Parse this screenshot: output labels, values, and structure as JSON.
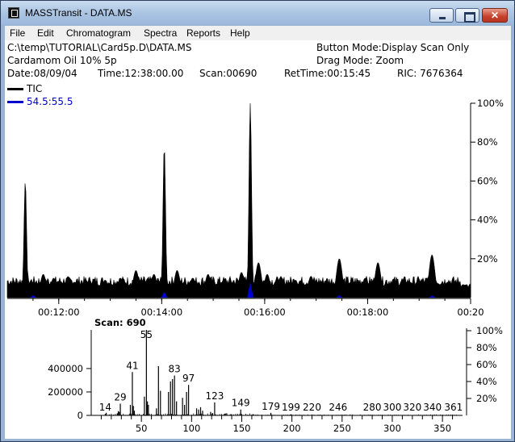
{
  "window": {
    "title": "MASSTransit - DATA.MS"
  },
  "menu": [
    "File",
    "Edit",
    "Chromatogram",
    "Spectra",
    "Reports",
    "Help"
  ],
  "info": {
    "path": "C:\\temp\\TUTORIAL\\Card5p.D\\DATA.MS",
    "sample": "Cardamom Oil 10% 5p",
    "date": "Date:08/09/04",
    "time": "Time:12:38:00.00",
    "scan": "Scan:00690",
    "rettime": "RetTime:00:15:45",
    "ric": "RIC:  7676364",
    "button_mode": "Button Mode:Display Scan Only",
    "drag_mode": "Drag Mode:  Zoom"
  },
  "legend": [
    {
      "name": "TIC",
      "color": "#000000"
    },
    {
      "name": "54.5:55.5",
      "color": "#0000cc"
    }
  ],
  "chart_data": [
    {
      "type": "area",
      "x_tick_labels": [
        "00:12:00",
        "00:14:00",
        "00:16:00",
        "00:18:00",
        "00:20"
      ],
      "y_tick_labels": [
        "100%",
        "80%",
        "60%",
        "40%",
        "20%"
      ],
      "series": [
        {
          "name": "TIC",
          "color": "#000000",
          "x": [
            11.03,
            11.35,
            11.5,
            11.7,
            11.9,
            12.1,
            12.3,
            12.6,
            12.9,
            13.2,
            13.5,
            13.85,
            14.05,
            14.3,
            14.6,
            14.9,
            15.2,
            15.55,
            15.72,
            15.88,
            16.05,
            16.3,
            16.6,
            16.9,
            17.2,
            17.45,
            17.7,
            17.95,
            18.2,
            18.5,
            18.75,
            19.0,
            19.25,
            19.55,
            19.85,
            20.0
          ],
          "values": [
            4,
            60,
            8,
            12,
            10,
            8,
            8,
            9,
            9,
            10,
            14,
            12,
            78,
            14,
            10,
            12,
            9,
            13,
            100,
            18,
            12,
            10,
            9,
            11,
            9,
            20,
            9,
            10,
            18,
            9,
            8,
            9,
            22,
            8,
            5,
            5
          ]
        },
        {
          "name": "54.5:55.5",
          "color": "#0000cc",
          "x": [
            11.5,
            14.05,
            15.72,
            17.45,
            19.25
          ],
          "values": [
            1,
            3,
            8,
            1,
            1
          ]
        }
      ]
    },
    {
      "type": "bar",
      "title": "Scan: 690",
      "x_range": [
        0,
        370
      ],
      "y_range": [
        0,
        730000
      ],
      "x_tick_labels": [
        "50",
        "100",
        "150",
        "200",
        "250",
        "300",
        "350"
      ],
      "y_tick_labels": [
        "400000",
        "200000",
        "0"
      ],
      "y2_tick_labels": [
        "100%",
        "80%",
        "60%",
        "40%",
        "20%"
      ],
      "mz": [
        14,
        15,
        18,
        26,
        27,
        28,
        29,
        39,
        41,
        42,
        43,
        53,
        55,
        56,
        57,
        65,
        67,
        69,
        77,
        79,
        81,
        83,
        85,
        91,
        93,
        95,
        97,
        105,
        107,
        109,
        111,
        119,
        121,
        123,
        133,
        135,
        139,
        149,
        161,
        179,
        199,
        220,
        246,
        280,
        300,
        320,
        340,
        361
      ],
      "intensity": [
        12000,
        22000,
        8000,
        18000,
        36000,
        30000,
        100000,
        90000,
        370000,
        80000,
        40000,
        160000,
        730000,
        120000,
        90000,
        60000,
        420000,
        210000,
        200000,
        290000,
        310000,
        340000,
        120000,
        150000,
        90000,
        200000,
        260000,
        60000,
        50000,
        70000,
        40000,
        30000,
        20000,
        110000,
        15000,
        18000,
        10000,
        50000,
        10000,
        22000,
        9000,
        8000,
        4000,
        6000,
        3000,
        3000,
        3000,
        2000
      ],
      "peak_labels": [
        "14",
        "29",
        "41",
        "55",
        "83",
        "97",
        "123",
        "149",
        "179",
        "199",
        "220",
        "246",
        "280",
        "300",
        "320",
        "340",
        "361"
      ]
    }
  ]
}
